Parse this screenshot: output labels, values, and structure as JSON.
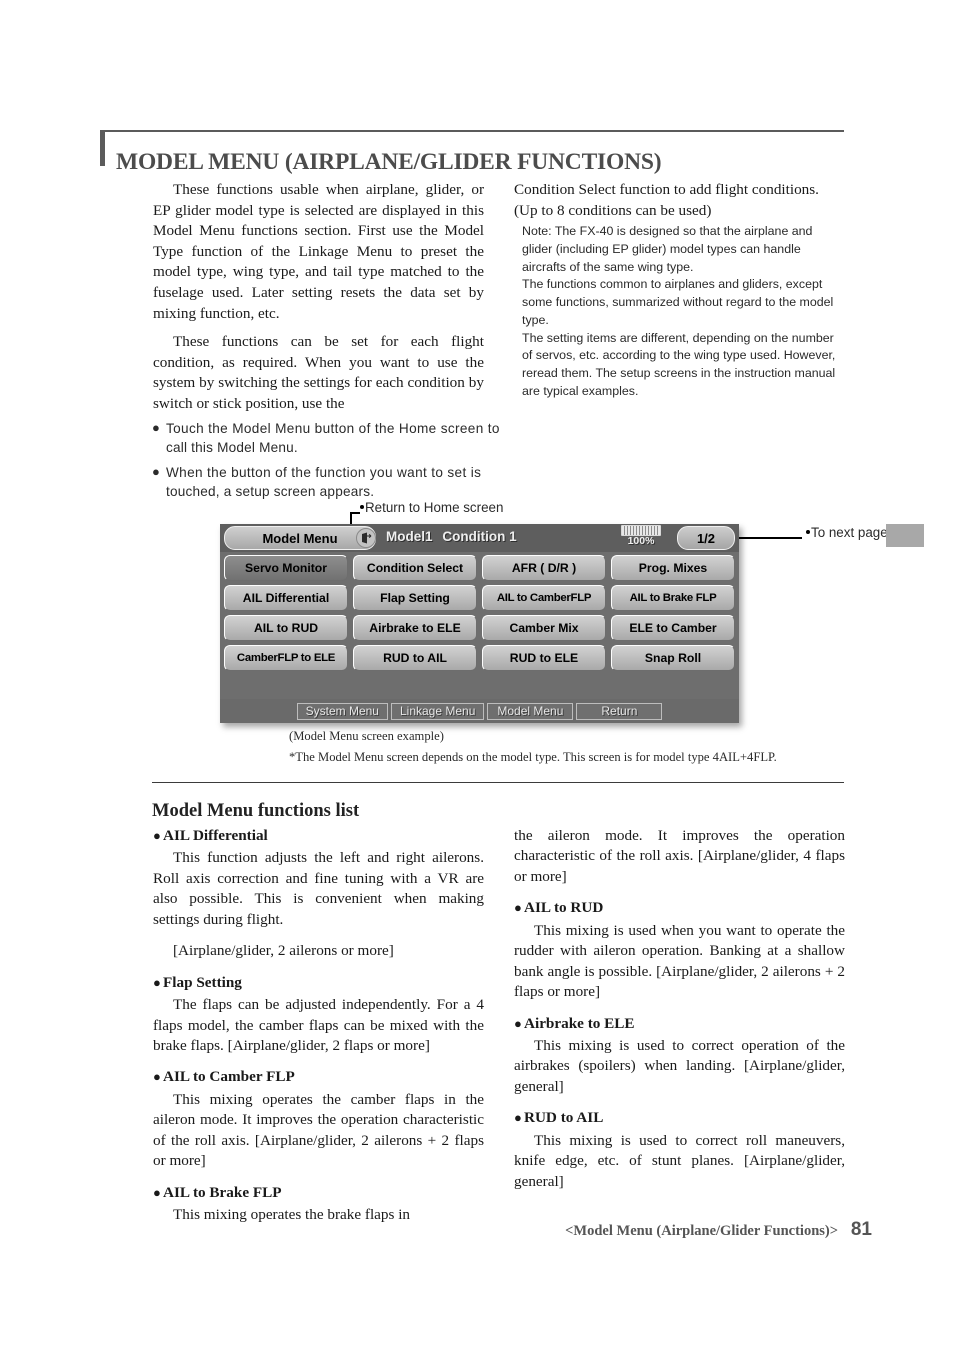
{
  "page": {
    "title": "MODEL MENU (AIRPLANE/GLIDER FUNCTIONS)",
    "number": "81",
    "footer_label": "<Model Menu (Airplane/Glider Functions)>"
  },
  "intro": {
    "left_paragraphs": [
      "These functions usable when airplane, glider, or EP glider model type is selected are displayed in this Model Menu functions section. First use the Model Type function of the Linkage Menu to preset the model type, wing type, and tail type matched to the fuselage used. Later setting resets the data set by mixing function, etc.",
      "These functions can be set for each flight condition, as required. When you want to use the system by switching the settings for each condition by switch or stick position, use the"
    ],
    "right_lead": [
      "Condition Select function to add flight conditions.",
      "(Up to 8 conditions can be used)"
    ],
    "right_notes": [
      "Note: The FX-40 is designed so that the airplane and glider (including EP glider) model types can handle aircrafts of the same wing type.",
      "The functions common to airplanes and gliders, except some functions, summarized without regard to the model type.",
      "The setting items are different, depending on the number of servos, etc. according to the wing type used. However, reread them. The setup screens in the instruction manual are typical examples."
    ]
  },
  "bullets": [
    {
      "line1": "Touch the Model Menu button of the Home screen to",
      "line2": "call this Model Menu."
    },
    {
      "line1": "When the button of the function you want to set is",
      "line2": "touched, a setup screen appears."
    }
  ],
  "callouts": {
    "return_home": "Return to Home screen",
    "next_page": "To next page"
  },
  "lcd": {
    "title_button": "Model Menu",
    "home_icon": "home-return-icon",
    "model_name": "Model1",
    "condition": "Condition 1",
    "battery_percent": "100%",
    "battery_icon": "battery-icon",
    "page_indicator": "1/2",
    "rows": [
      [
        {
          "label": "Servo Monitor",
          "selected": true
        },
        {
          "label": "Condition Select",
          "selected": false
        },
        {
          "label": "AFR ( D/R )",
          "selected": false
        },
        {
          "label": "Prog. Mixes",
          "selected": false
        }
      ],
      [
        {
          "label": "AIL Differential",
          "selected": false
        },
        {
          "label": "Flap Setting",
          "selected": false
        },
        {
          "label": "AIL to CamberFLP",
          "selected": false,
          "tight": true
        },
        {
          "label": "AIL to Brake FLP",
          "selected": false,
          "tight": true
        }
      ],
      [
        {
          "label": "AIL to RUD",
          "selected": false
        },
        {
          "label": "Airbrake to ELE",
          "selected": false
        },
        {
          "label": "Camber Mix",
          "selected": false
        },
        {
          "label": "ELE to Camber",
          "selected": false
        }
      ],
      [
        {
          "label": "CamberFLP to ELE",
          "selected": false,
          "tight": true
        },
        {
          "label": "RUD to AIL",
          "selected": false
        },
        {
          "label": "RUD to ELE",
          "selected": false
        },
        {
          "label": "Snap Roll",
          "selected": false
        }
      ]
    ],
    "footer_tabs": [
      "System Menu",
      "Linkage Menu",
      "Model Menu",
      "Return"
    ]
  },
  "captions": {
    "line1": "(Model Menu screen example)",
    "line2": "*The Model Menu screen depends on the model type. This screen is for model type 4AIL+4FLP."
  },
  "section": {
    "heading": "Model Menu functions list"
  },
  "functions_left": [
    {
      "name": "AIL Differential",
      "body": "This function adjusts the left and right ailerons. Roll axis correction and fine tuning with a VR are also possible. This is convenient when making settings during flight.",
      "extra": "[Airplane/glider, 2 ailerons or more]"
    },
    {
      "name": "Flap Setting",
      "body": "The flaps can be adjusted independently. For a 4 flaps model, the camber flaps can be mixed with the brake flaps. [Airplane/glider, 2 flaps or more]"
    },
    {
      "name": "AIL to Camber FLP",
      "body": "This mixing operates the camber flaps in the aileron mode. It improves the operation characteristic of the roll axis. [Airplane/glider, 2 ailerons + 2 flaps or more]"
    },
    {
      "name": "AIL to Brake FLP",
      "body": "This mixing operates the brake flaps in"
    }
  ],
  "functions_right": [
    {
      "name": "",
      "body_cont": "the aileron mode. It improves the operation characteristic of the roll axis. [Airplane/glider, 4 flaps or more]"
    },
    {
      "name": "AIL to RUD",
      "body": "This mixing is used when you want to operate the rudder with aileron operation. Banking at a shallow bank angle is possible. [Airplane/glider, 2 ailerons + 2 flaps or more]"
    },
    {
      "name": "Airbrake to ELE",
      "body": "This mixing is used to correct operation of the airbrakes (spoilers) when landing. [Airplane/glider, general]"
    },
    {
      "name": "RUD to AIL",
      "body": "This mixing is used to correct roll maneuvers, knife edge, etc. of stunt planes. [Airplane/glider, general]"
    }
  ]
}
